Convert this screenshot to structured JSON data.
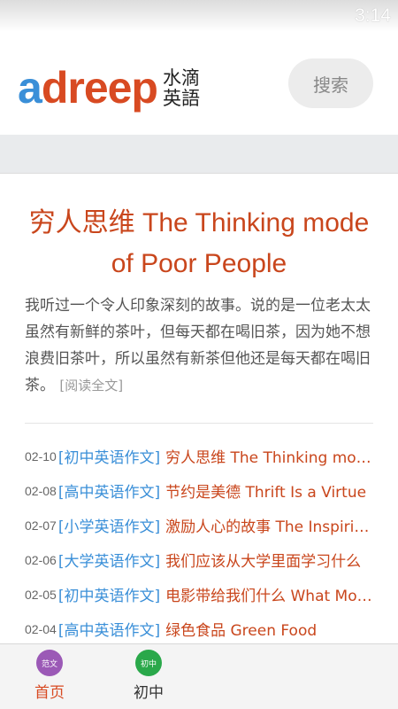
{
  "status_bar": {
    "time": "3:14"
  },
  "header": {
    "logo_a": "a",
    "logo_rest": "dreep",
    "logo_cn_line1": "水滴",
    "logo_cn_line2": "英語",
    "search_label": "搜索"
  },
  "article": {
    "title": "穷人思维 The Thinking mode of Poor People",
    "summary": "我听过一个令人印象深刻的故事。说的是一位老太太虽然有新鲜的茶叶，但每天都在喝旧茶，因为她不想浪费旧茶叶，所以虽然有新茶但他还是每天都在喝旧茶。",
    "read_more": "[阅读全文]"
  },
  "list": [
    {
      "date": "02-10",
      "category": "[初中英语作文]",
      "title": "穷人思维 The Thinking mode of Poor People"
    },
    {
      "date": "02-08",
      "category": "[高中英语作文]",
      "title": "节约是美德 Thrift Is a Virtue"
    },
    {
      "date": "02-07",
      "category": "[小学英语作文]",
      "title": "激励人心的故事 The Inspiring Story"
    },
    {
      "date": "02-06",
      "category": "[大学英语作文]",
      "title": "我们应该从大学里面学习什么"
    },
    {
      "date": "02-05",
      "category": "[初中英语作文]",
      "title": "电影带给我们什么 What Movies Bring Us"
    },
    {
      "date": "02-04",
      "category": "[高中英语作文]",
      "title": "绿色食品 Green Food"
    }
  ],
  "bottom_nav": {
    "home": {
      "icon_text": "范文",
      "label": "首页",
      "icon": "essay-icon"
    },
    "junior": {
      "icon_text": "初中",
      "label": "初中",
      "icon": "junior-icon"
    }
  },
  "colors": {
    "accent_red": "#c9461c",
    "link_blue": "#3a8fd8",
    "home_icon": "#9b59b6",
    "junior_icon": "#2aa84a"
  }
}
